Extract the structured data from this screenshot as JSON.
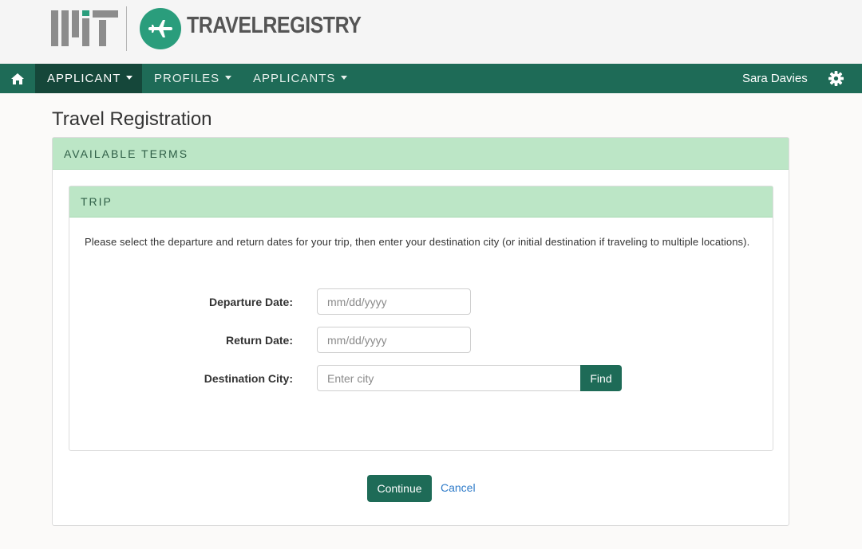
{
  "header": {
    "logo_text": "MIT",
    "brand": "TRAVELREGISTRY"
  },
  "nav": {
    "home_icon": "home-icon",
    "items": [
      {
        "label": "APPLICANT",
        "active": true
      },
      {
        "label": "PROFILES",
        "active": false
      },
      {
        "label": "APPLICANTS",
        "active": false
      }
    ],
    "user_name": "Sara Davies",
    "settings_icon": "gear-icon"
  },
  "page": {
    "title": "Travel Registration"
  },
  "terms_panel": {
    "heading": "AVAILABLE TERMS"
  },
  "trip_panel": {
    "heading": "TRIP",
    "instructions": "Please select the departure and return dates for your trip, then enter your destination city (or initial destination if traveling to multiple locations).",
    "fields": {
      "departure": {
        "label": "Departure Date:",
        "placeholder": "mm/dd/yyyy",
        "value": ""
      },
      "return": {
        "label": "Return Date:",
        "placeholder": "mm/dd/yyyy",
        "value": ""
      },
      "destination": {
        "label": "Destination City:",
        "placeholder": "Enter city",
        "value": ""
      }
    },
    "find_label": "Find"
  },
  "actions": {
    "continue_label": "Continue",
    "cancel_label": "Cancel"
  },
  "colors": {
    "nav_bg": "#1e6b57",
    "nav_active_bg": "#15473a",
    "panel_header_bg": "#bce6c6",
    "accent_green": "#2a9d7c",
    "link_blue": "#2f7bc9"
  }
}
